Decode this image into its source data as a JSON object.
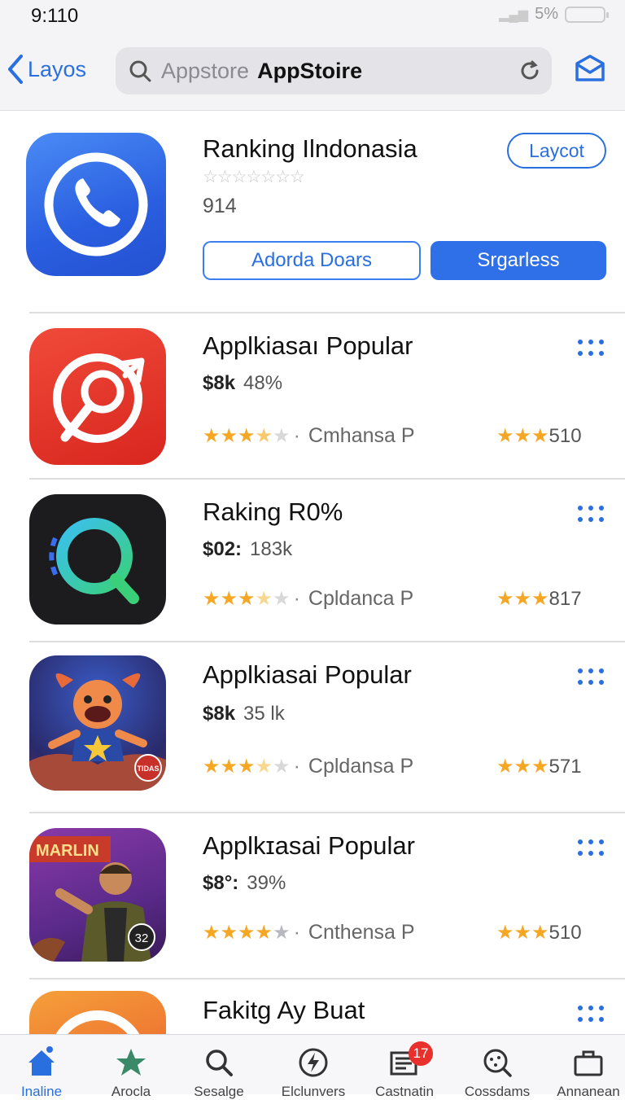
{
  "status_bar": {
    "time": "9:110",
    "battery": "5%"
  },
  "header": {
    "back_label": "Layos",
    "search_placeholder": "Appstore",
    "search_value": "AppStoire"
  },
  "featured": {
    "title": "Ranking Ilndonasia",
    "stars": "☆☆☆☆☆☆☆",
    "count": "914",
    "pill_label": "Laycot",
    "outline_label": "Adorda Doars",
    "solid_label": "Srgarless"
  },
  "apps": [
    {
      "title": "Applkiasaı Popular",
      "price": "$8k",
      "sub": "48%",
      "left_label": "Cmhansa P",
      "right_value": "510",
      "stars_on": 3,
      "half": true
    },
    {
      "title": "Raking R0%",
      "price": "$02:",
      "sub": "183k",
      "left_label": "Cpldanca P",
      "right_value": "817",
      "stars_on": 3,
      "half": true
    },
    {
      "title": "Applkiasai Popular",
      "price": "$8k",
      "sub": "35 lk",
      "left_label": "Cpldansa P",
      "right_value": "571",
      "stars_on": 3,
      "half": true
    },
    {
      "title": "Applkɪasai Popular",
      "price": "$8°:",
      "sub": "39%",
      "left_label": "Cnthensa P",
      "right_value": "510",
      "stars_on": 4,
      "half": false
    },
    {
      "title": "Fakitg Ay Buat",
      "price": "",
      "sub": "",
      "left_label": "",
      "right_value": "",
      "stars_on": 0,
      "half": false
    }
  ],
  "tabs": [
    {
      "label": "Inaline",
      "icon": "home-icon",
      "active": true
    },
    {
      "label": "Arocla",
      "icon": "star-icon",
      "active": false
    },
    {
      "label": "Sesalge",
      "icon": "search-icon",
      "active": false
    },
    {
      "label": "Elclunvers",
      "icon": "bolt-icon",
      "active": false
    },
    {
      "label": "Castnatin",
      "icon": "news-icon",
      "active": false,
      "badge": "17"
    },
    {
      "label": "Cossdams",
      "icon": "face-search-icon",
      "active": false
    },
    {
      "label": "Annanean",
      "icon": "briefcase-icon",
      "active": false
    }
  ],
  "icon_badges": {
    "app3": "TIDAS",
    "app4_banner": "MARLIN",
    "app4_corner": "32"
  },
  "colors": {
    "accent": "#2a6fe0",
    "star": "#f5a623",
    "badge": "#e8312c"
  }
}
